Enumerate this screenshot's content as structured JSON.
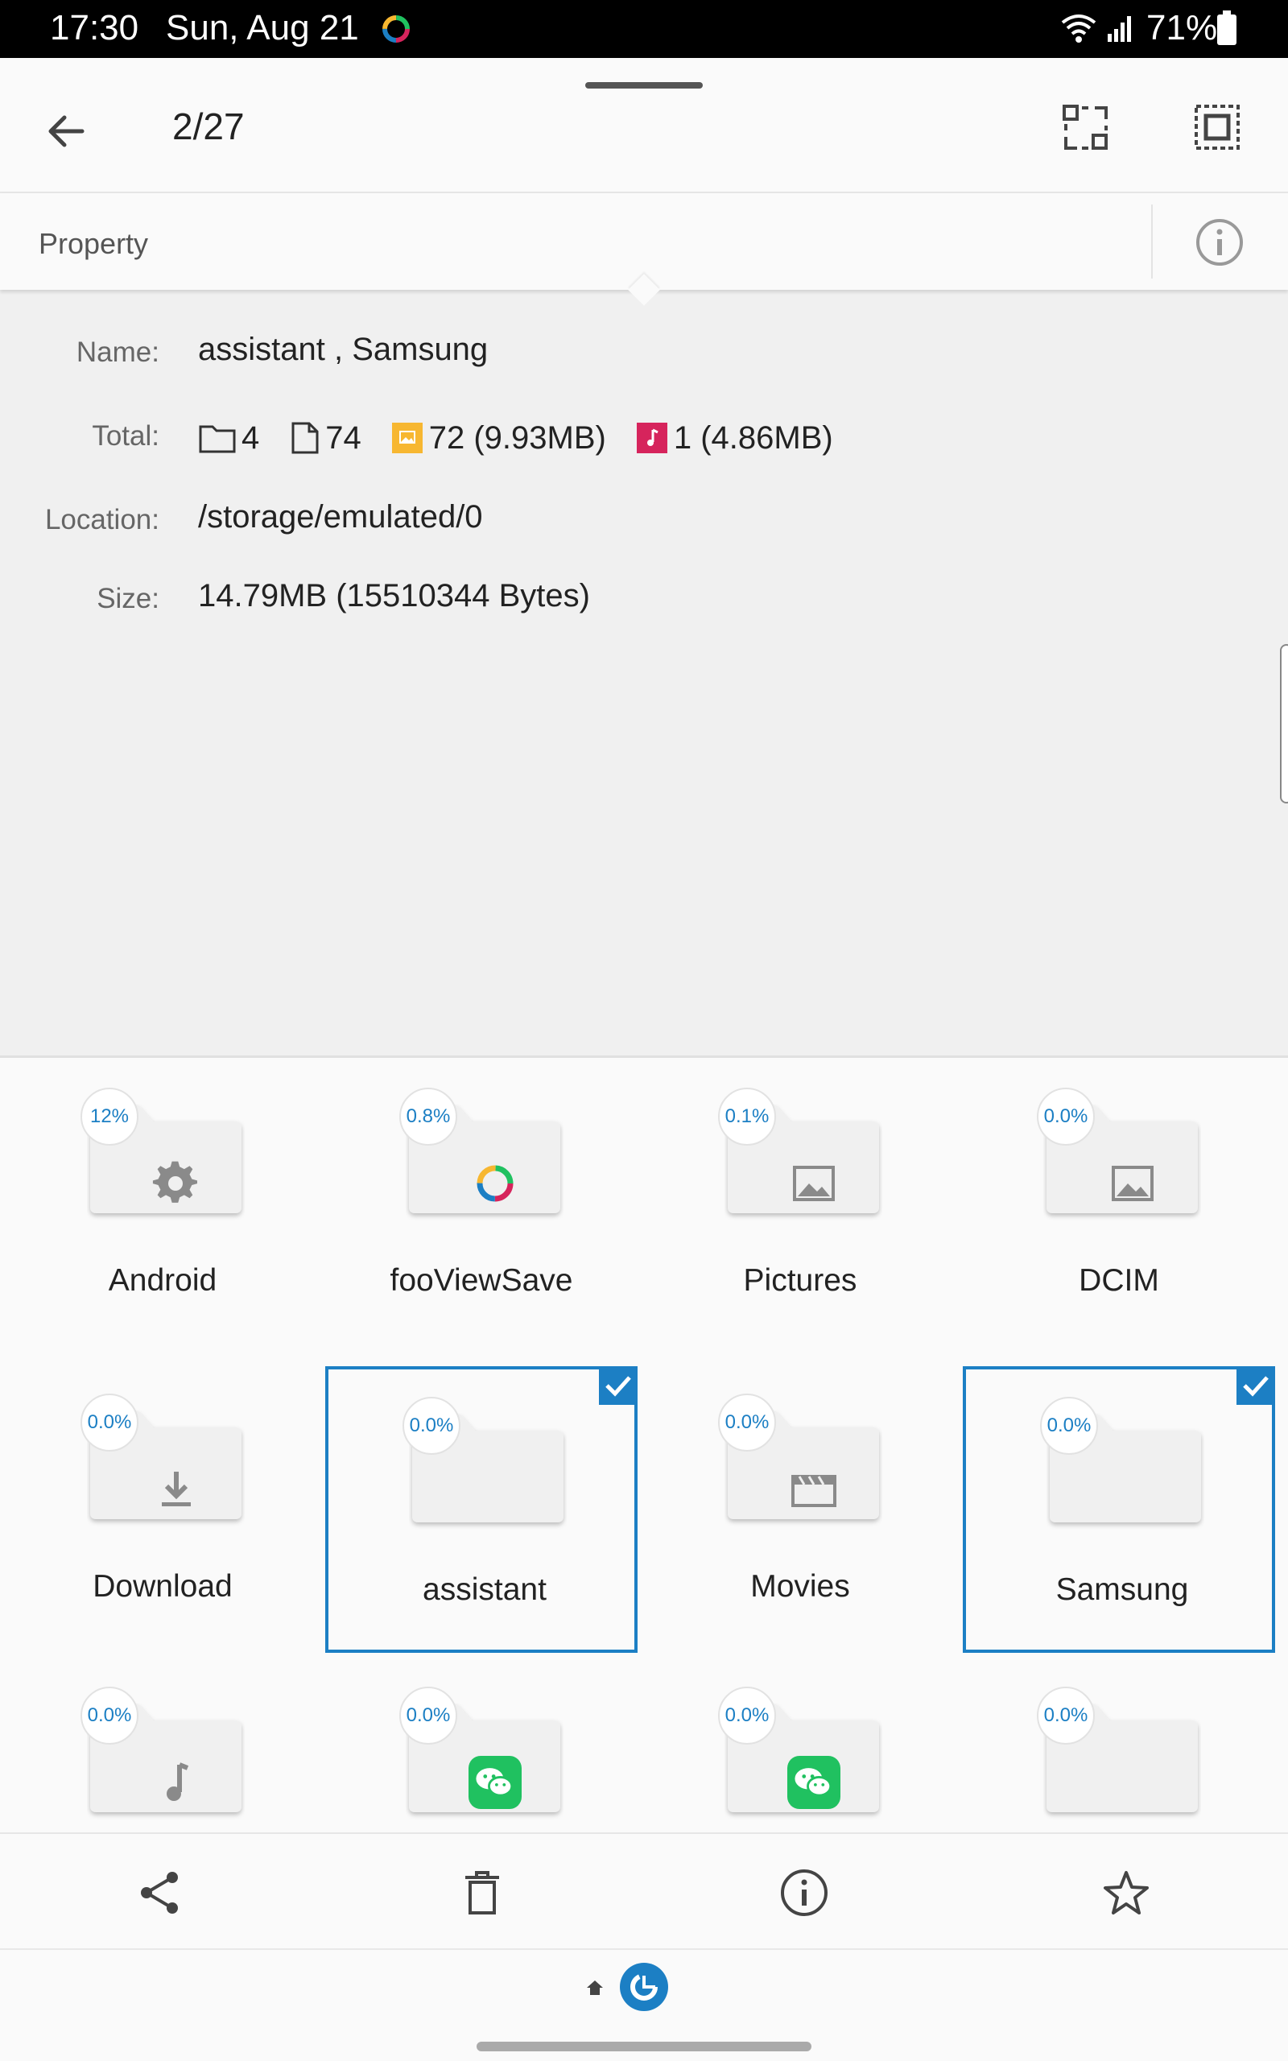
{
  "status_bar": {
    "time": "17:30",
    "date": "Sun, Aug 21",
    "battery": "71%"
  },
  "header": {
    "selection_count": "2/27"
  },
  "tab": {
    "label": "Property"
  },
  "properties": {
    "name_label": "Name:",
    "name_value": "assistant , Samsung",
    "total_label": "Total:",
    "totals": {
      "folders": "4",
      "files": "74",
      "images": "72 (9.93MB)",
      "music": "1 (4.86MB)"
    },
    "location_label": "Location:",
    "location_value": "/storage/emulated/0",
    "size_label": "Size:",
    "size_value": "14.79MB (15510344 Bytes)"
  },
  "folders": [
    {
      "name": "Android",
      "percent": "12%",
      "icon": "gear-icon",
      "selected": false
    },
    {
      "name": "fooViewSave",
      "percent": "0.8%",
      "icon": "fooview-logo-icon",
      "selected": false
    },
    {
      "name": "Pictures",
      "percent": "0.1%",
      "icon": "image-icon",
      "selected": false
    },
    {
      "name": "DCIM",
      "percent": "0.0%",
      "icon": "image-icon",
      "selected": false
    },
    {
      "name": "Download",
      "percent": "0.0%",
      "icon": "download-icon",
      "selected": false
    },
    {
      "name": "assistant",
      "percent": "0.0%",
      "icon": "",
      "selected": true
    },
    {
      "name": "Movies",
      "percent": "0.0%",
      "icon": "film-icon",
      "selected": false
    },
    {
      "name": "Samsung",
      "percent": "0.0%",
      "icon": "",
      "selected": true
    },
    {
      "name": "",
      "percent": "0.0%",
      "icon": "music-note-icon",
      "selected": false
    },
    {
      "name": "",
      "percent": "0.0%",
      "icon": "wechat-icon",
      "selected": false
    },
    {
      "name": "",
      "percent": "0.0%",
      "icon": "wechat-icon",
      "selected": false
    },
    {
      "name": "",
      "percent": "0.0%",
      "icon": "",
      "selected": false
    }
  ],
  "actions": [
    "share-icon",
    "delete-icon",
    "info-icon",
    "star-icon"
  ],
  "colors": {
    "accent": "#1c7fc4",
    "wechat_green": "#20c160",
    "image_yellow": "#f7b731",
    "music_magenta": "#d6245c"
  }
}
